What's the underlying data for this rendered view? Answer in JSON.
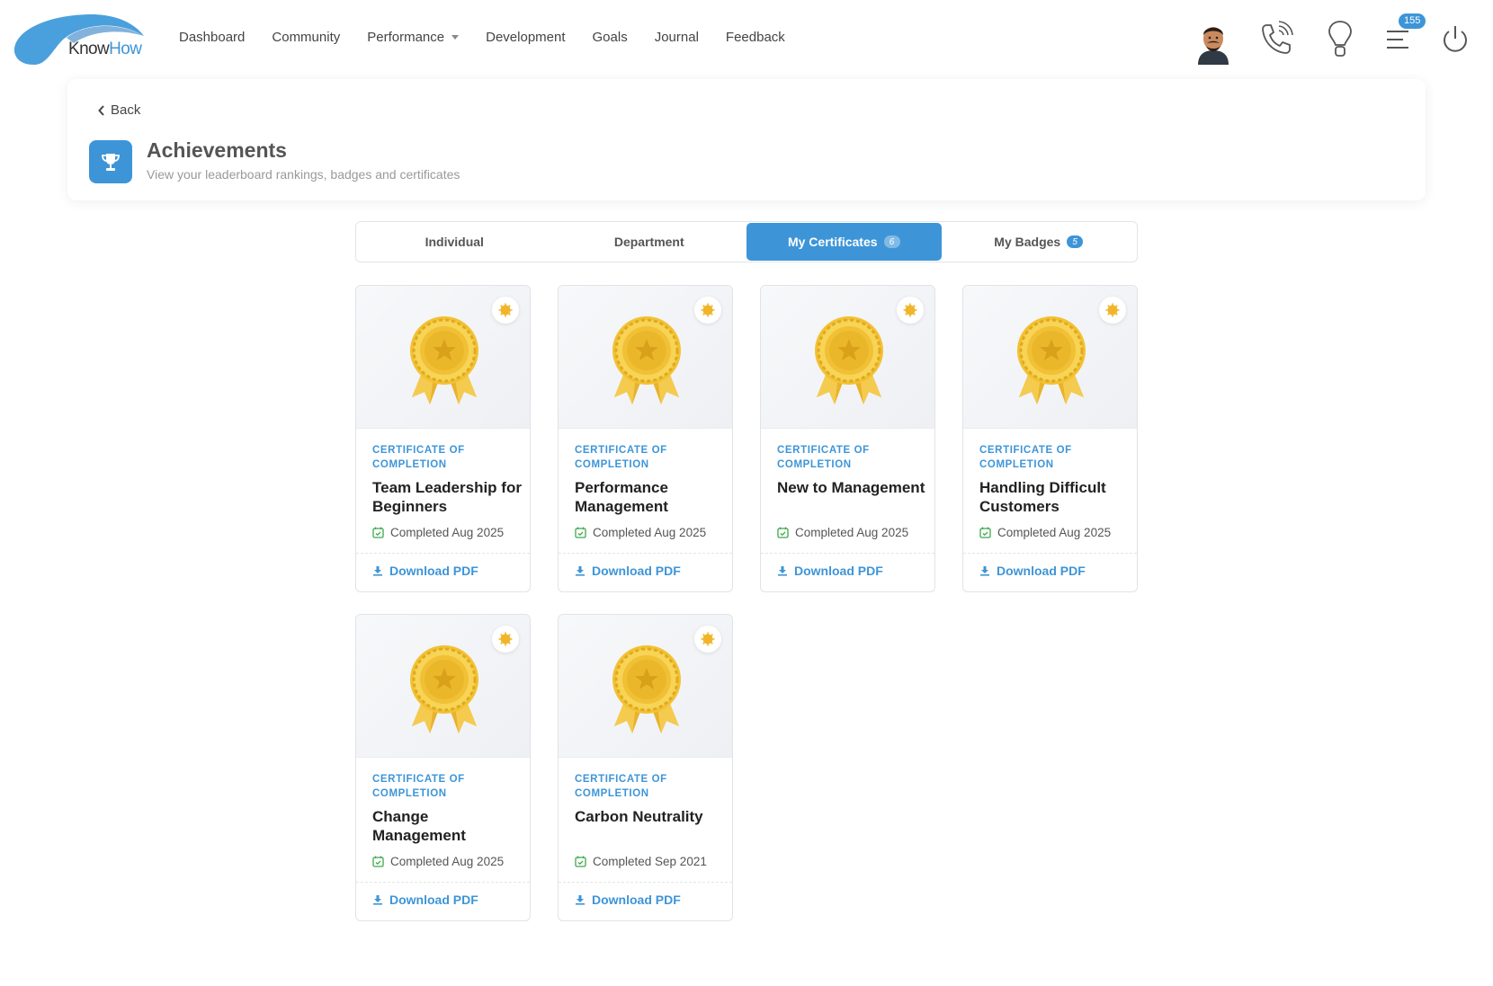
{
  "brand": {
    "name_part1": "Know",
    "name_part2": "How",
    "accent": "#3d95d8"
  },
  "nav": [
    {
      "label": "Dashboard"
    },
    {
      "label": "Community"
    },
    {
      "label": "Performance",
      "has_dropdown": true
    },
    {
      "label": "Development"
    },
    {
      "label": "Goals"
    },
    {
      "label": "Journal"
    },
    {
      "label": "Feedback"
    }
  ],
  "header_icons": [
    "avatar",
    "phone-icon",
    "lightbulb-icon",
    "menu-icon",
    "power-icon"
  ],
  "notifications": {
    "count": "155"
  },
  "page": {
    "back_label": "Back",
    "title": "Achievements",
    "subtitle": "View your leaderboard rankings, badges and certificates"
  },
  "tabs": [
    {
      "label": "Individual",
      "count": "",
      "active": false
    },
    {
      "label": "Department",
      "count": "",
      "active": false
    },
    {
      "label": "My Certificates",
      "count": "6",
      "active": true
    },
    {
      "label": "My Badges",
      "count": "5",
      "active": false
    }
  ],
  "certificates": [
    {
      "kind": "Certificate of Completion",
      "name": "Team Leadership for Beginners",
      "completed": "Completed Aug 2025",
      "action": "Download PDF"
    },
    {
      "kind": "Certificate of Completion",
      "name": "Performance Management",
      "completed": "Completed Aug 2025",
      "action": "Download PDF"
    },
    {
      "kind": "Certificate of Completion",
      "name": "New to Management",
      "completed": "Completed Aug 2025",
      "action": "Download PDF"
    },
    {
      "kind": "Certificate of Completion",
      "name": "Handling Difficult Customers",
      "completed": "Completed Aug 2025",
      "action": "Download PDF"
    },
    {
      "kind": "Certificate of Completion",
      "name": "Change Management",
      "completed": "Completed Aug 2025",
      "action": "Download PDF"
    },
    {
      "kind": "Certificate of Completion",
      "name": "Carbon Neutrality",
      "completed": "Completed Sep 2021",
      "action": "Download PDF"
    }
  ]
}
